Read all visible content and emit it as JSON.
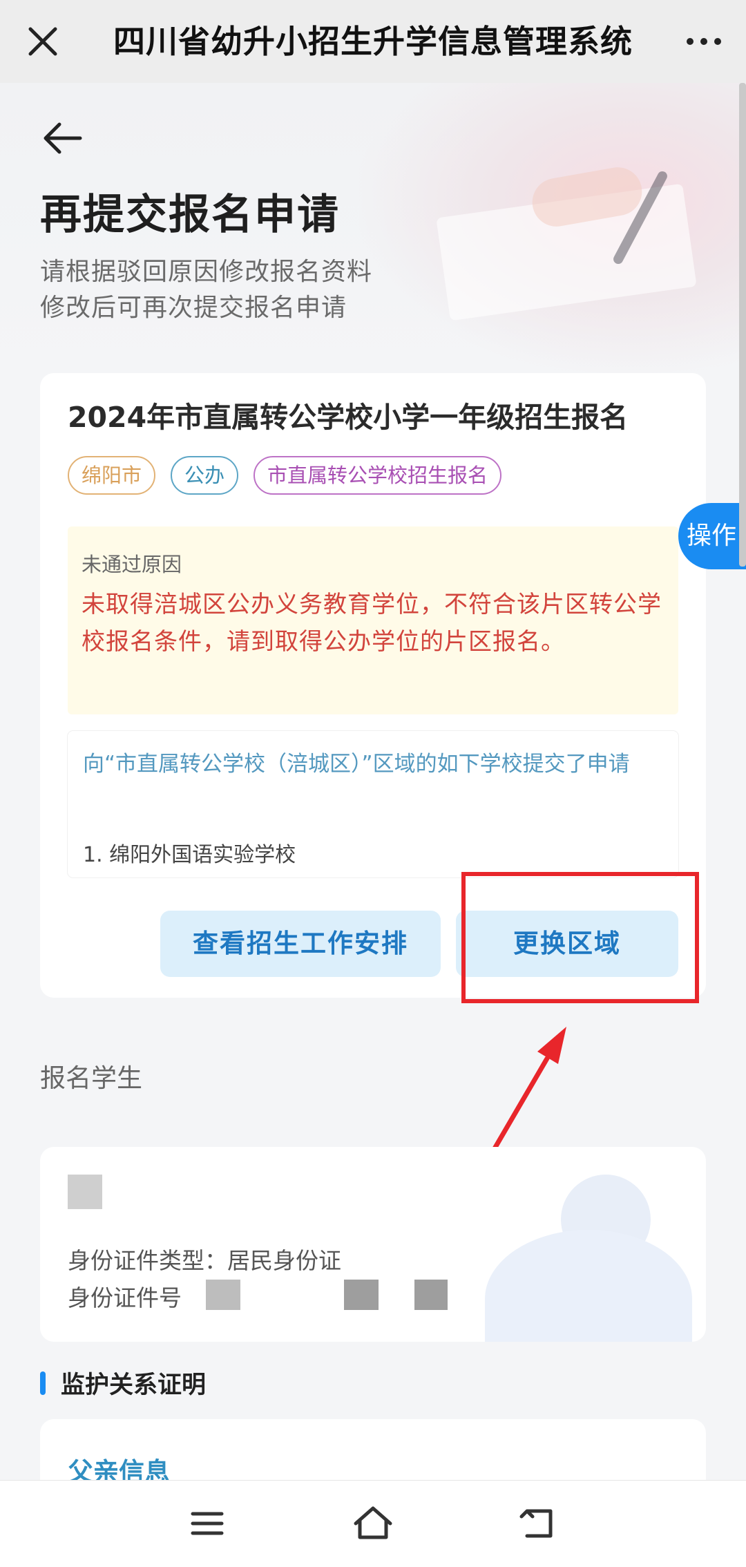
{
  "topbar": {
    "title": "四川省幼升小招生升学信息管理系统",
    "close_icon": "close-icon",
    "more_icon": "more-dots-icon"
  },
  "hero": {
    "title": "再提交报名申请",
    "subtitle_line1": "请根据驳回原因修改报名资料",
    "subtitle_line2": "修改后可再次提交报名申请"
  },
  "card": {
    "title": "2024年市直属转公学校小学一年级招生报名",
    "tags": [
      "绵阳市",
      "公办",
      "市直属转公学校招生报名"
    ],
    "reason_label": "未通过原因",
    "reason_text": "未取得涪城区公办义务教育学位，不符合该片区转公学校报名条件，请到取得公办学位的片区报名。",
    "applied_text": "向“市直属转公学校（涪城区）”区域的如下学校提交了申请",
    "applied_item": "1. 绵阳外国语实验学校",
    "button_schedule": "查看招生工作安排",
    "button_change_area": "更换区域"
  },
  "float_button": "操作",
  "student_section": {
    "label": "报名学生",
    "id_type_line": "身份证件类型：居民身份证",
    "id_number_label": "身份证件号"
  },
  "guardian": {
    "title": "监护关系证明",
    "father_info": "父亲信息"
  },
  "colors": {
    "accent": "#1a8cf2",
    "reason_text": "#d2443c",
    "highlight": "#e8262b"
  }
}
